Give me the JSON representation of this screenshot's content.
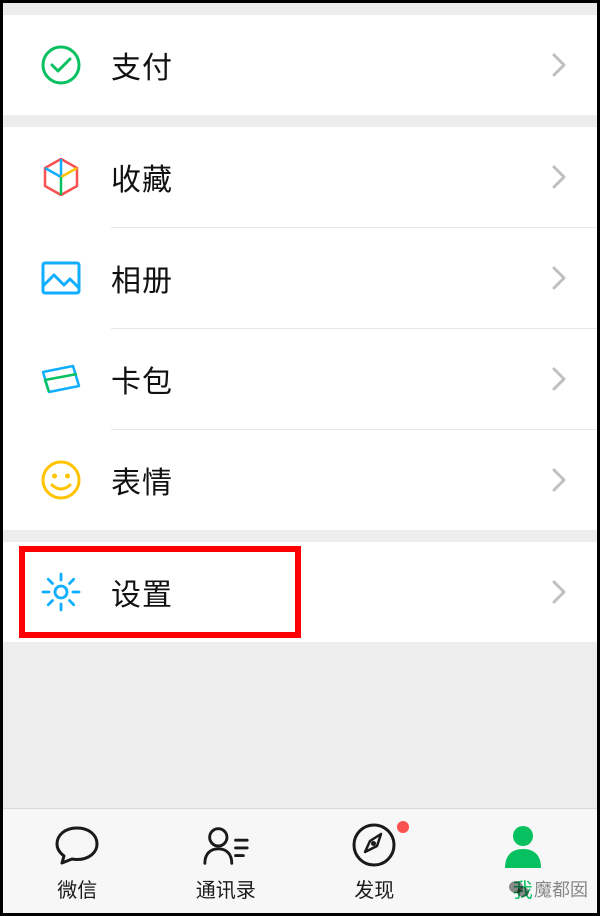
{
  "menu": {
    "pay": "支付",
    "favorites": "收藏",
    "album": "相册",
    "cards": "卡包",
    "stickers": "表情",
    "settings": "设置"
  },
  "tabs": {
    "chat": "微信",
    "contacts": "通讯录",
    "discover": "发现",
    "me": "我"
  },
  "watermark": "魔都囡",
  "colors": {
    "accent": "#07c160",
    "highlight": "#ff0000",
    "badge": "#fa5151"
  }
}
